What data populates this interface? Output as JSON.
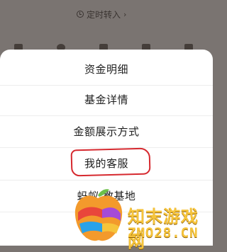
{
  "background": {
    "top_link": "定时转入",
    "top_link_icon": "clock-icon",
    "chevron": "›"
  },
  "sheet": {
    "items": [
      {
        "label": "资金明细"
      },
      {
        "label": "基金详情"
      },
      {
        "label": "金额展示方式"
      },
      {
        "label": "我的客服"
      },
      {
        "label": "蚂蚁 教基地"
      }
    ],
    "partial_bottom_label": "消"
  },
  "annotation": {
    "color": "#d6292f"
  },
  "watermark": {
    "cn": "知末游戏网",
    "en": "ZMO28.CN"
  }
}
